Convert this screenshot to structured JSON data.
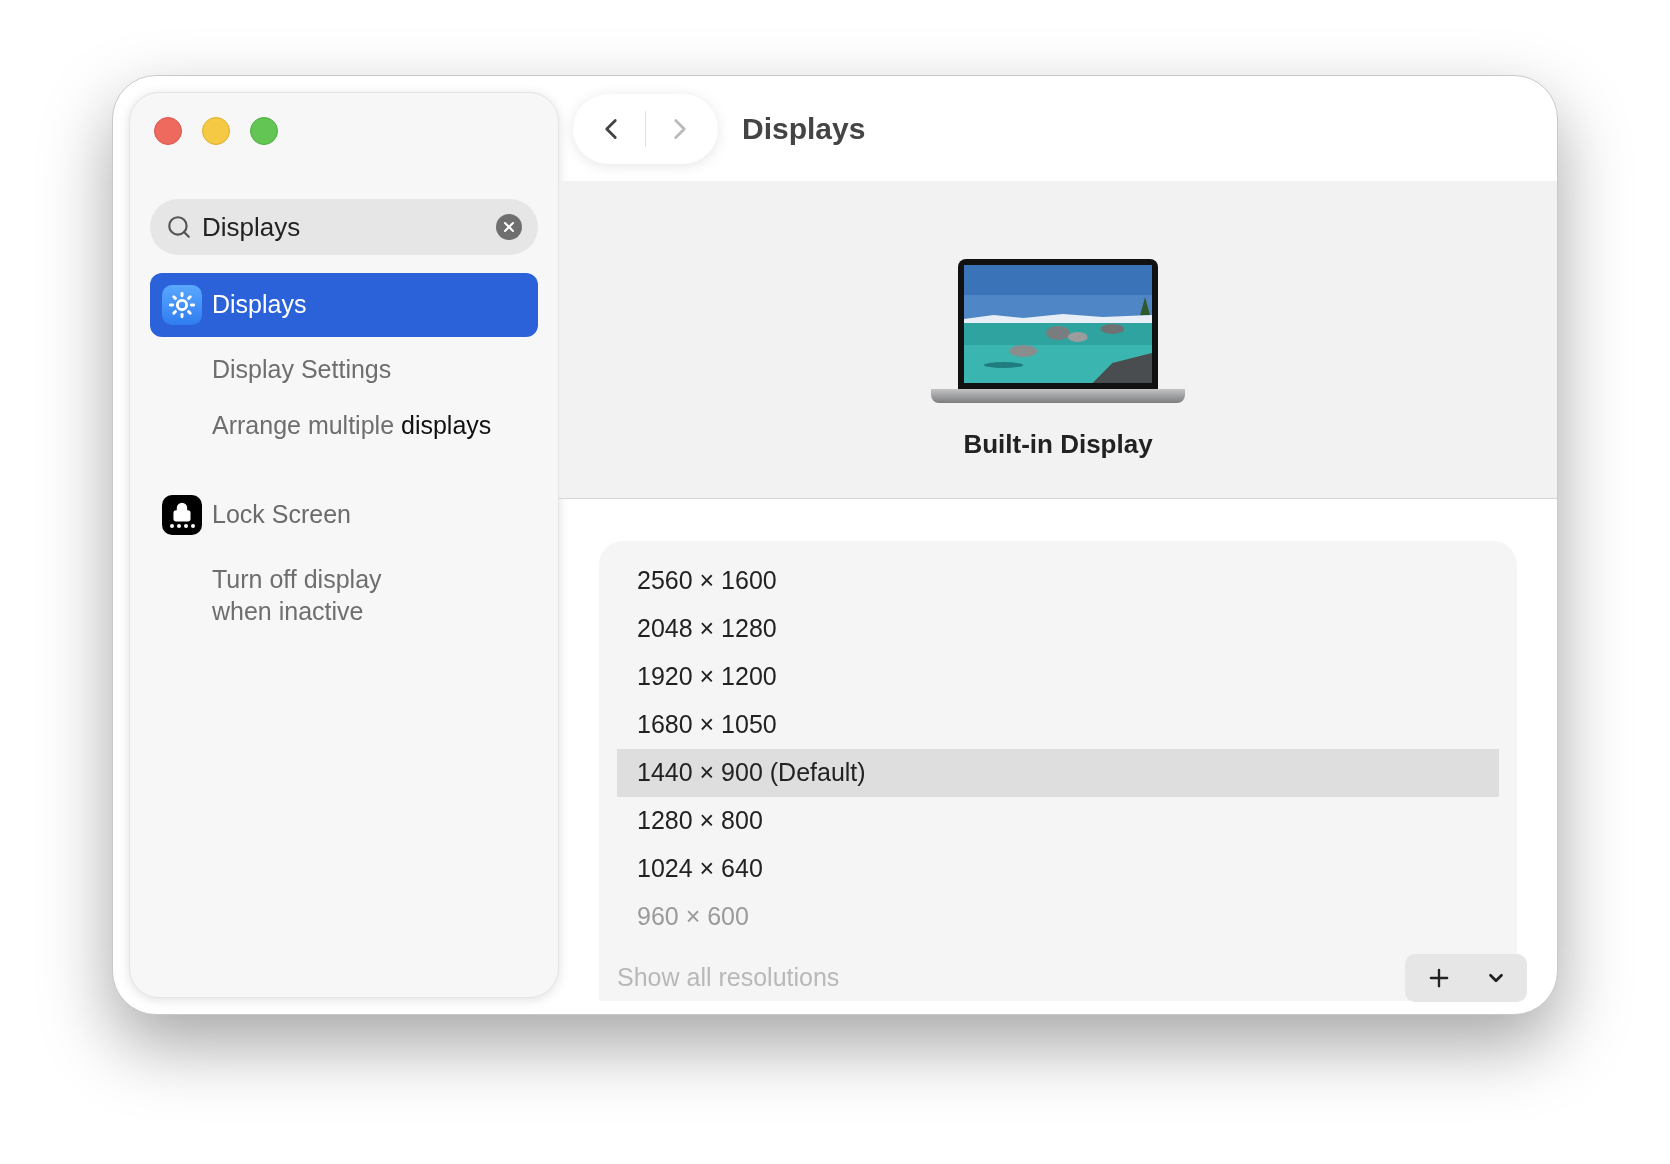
{
  "window": {
    "title": "Displays"
  },
  "nav": {
    "back_disabled": false,
    "forward_disabled": true
  },
  "search": {
    "value": "Displays"
  },
  "sidebar": {
    "items": [
      {
        "kind": "displays",
        "label": "Displays",
        "selected": true
      },
      {
        "kind": "sub",
        "label": "Display Settings",
        "selected": false
      },
      {
        "kind": "sub",
        "label": "Arrange multiple **displays**",
        "selected": false
      },
      {
        "kind": "lockscreen",
        "label": "Lock Screen",
        "selected": false
      },
      {
        "kind": "sub",
        "label": "Turn off display\nwhen inactive",
        "selected": false
      }
    ]
  },
  "display": {
    "name": "Built-in Display"
  },
  "resolutions": [
    {
      "label": "2560 × 1600",
      "selected": false,
      "faded": false
    },
    {
      "label": "2048 × 1280",
      "selected": false,
      "faded": false
    },
    {
      "label": "1920 × 1200",
      "selected": false,
      "faded": false
    },
    {
      "label": "1680 × 1050",
      "selected": false,
      "faded": false
    },
    {
      "label": "1440 × 900 (Default)",
      "selected": true,
      "faded": false
    },
    {
      "label": "1280 × 800",
      "selected": false,
      "faded": false
    },
    {
      "label": "1024 × 640",
      "selected": false,
      "faded": false
    },
    {
      "label": "960 × 600",
      "selected": false,
      "faded": true
    }
  ],
  "footer": {
    "label": "Show all resolutions",
    "faded": true
  }
}
